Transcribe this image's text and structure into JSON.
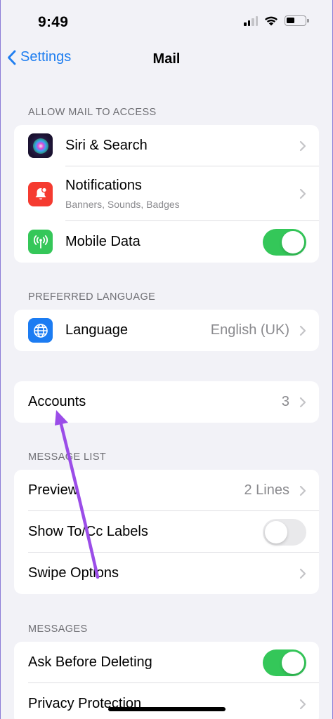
{
  "status_bar": {
    "time": "9:49"
  },
  "nav": {
    "back_label": "Settings",
    "title": "Mail"
  },
  "sections": {
    "allow_access": {
      "header": "ALLOW MAIL TO ACCESS",
      "siri": {
        "label": "Siri & Search",
        "icon": "siri-icon"
      },
      "notifications": {
        "label": "Notifications",
        "subtitle": "Banners, Sounds, Badges",
        "icon": "bell-icon",
        "icon_color": "#f53b30"
      },
      "mobile_data": {
        "label": "Mobile Data",
        "icon": "antenna-icon",
        "icon_color": "#35c759",
        "enabled": true
      }
    },
    "preferred_language": {
      "header": "PREFERRED LANGUAGE",
      "language": {
        "label": "Language",
        "value": "English (UK)",
        "icon": "globe-icon",
        "icon_color": "#1c7cf2"
      }
    },
    "accounts": {
      "label": "Accounts",
      "value": "3"
    },
    "message_list": {
      "header": "MESSAGE LIST",
      "preview": {
        "label": "Preview",
        "value": "2 Lines"
      },
      "show_to_cc": {
        "label": "Show To/Cc Labels",
        "enabled": false
      },
      "swipe_options": {
        "label": "Swipe Options"
      }
    },
    "messages": {
      "header": "MESSAGES",
      "ask_before_deleting": {
        "label": "Ask Before Deleting",
        "enabled": true
      },
      "privacy_protection": {
        "label": "Privacy Protection"
      }
    }
  },
  "colors": {
    "accent": "#1f7ef0",
    "toggle_on": "#34c759",
    "annotation_arrow": "#9b4de8",
    "background": "#f2f2f7"
  }
}
